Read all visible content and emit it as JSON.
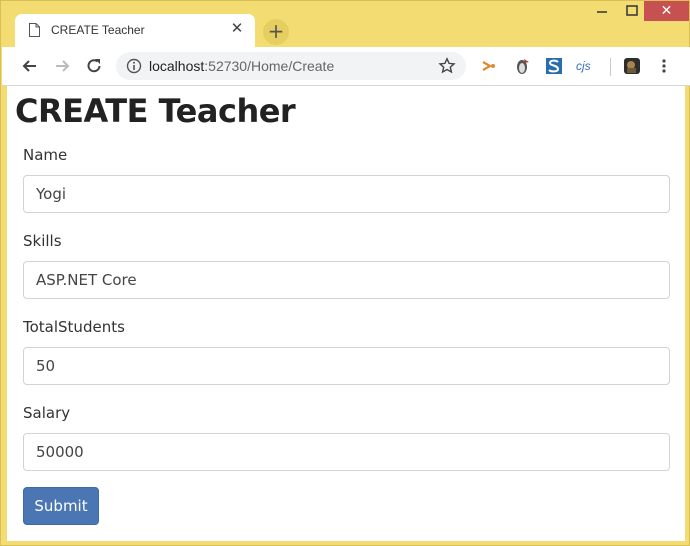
{
  "browser": {
    "tab_title": "CREATE Teacher",
    "tab_close_glyph": "✕",
    "new_tab_glyph": "+",
    "url_host": "localhost",
    "url_rest": ":52730/Home/Create",
    "icons": [
      "page-icon",
      "back-icon",
      "forward-icon",
      "reload-icon",
      "info-icon",
      "star-icon",
      "extension-arrow-icon",
      "extension-penguin-icon",
      "extension-s-icon",
      "extension-cjs-icon",
      "profile-avatar-icon",
      "menu-dots-icon"
    ],
    "ext_cjs_label": "cjs",
    "window_close_glyph": "✕",
    "colors": {
      "frame": "#f3dc72",
      "close_button": "#c75050",
      "submit_button": "#4a77b4"
    }
  },
  "page": {
    "title": "CREATE Teacher",
    "fields": [
      {
        "label": "Name",
        "value": "Yogi"
      },
      {
        "label": "Skills",
        "value": "ASP.NET Core"
      },
      {
        "label": "TotalStudents",
        "value": "50"
      },
      {
        "label": "Salary",
        "value": "50000"
      }
    ],
    "submit_label": "Submit"
  }
}
